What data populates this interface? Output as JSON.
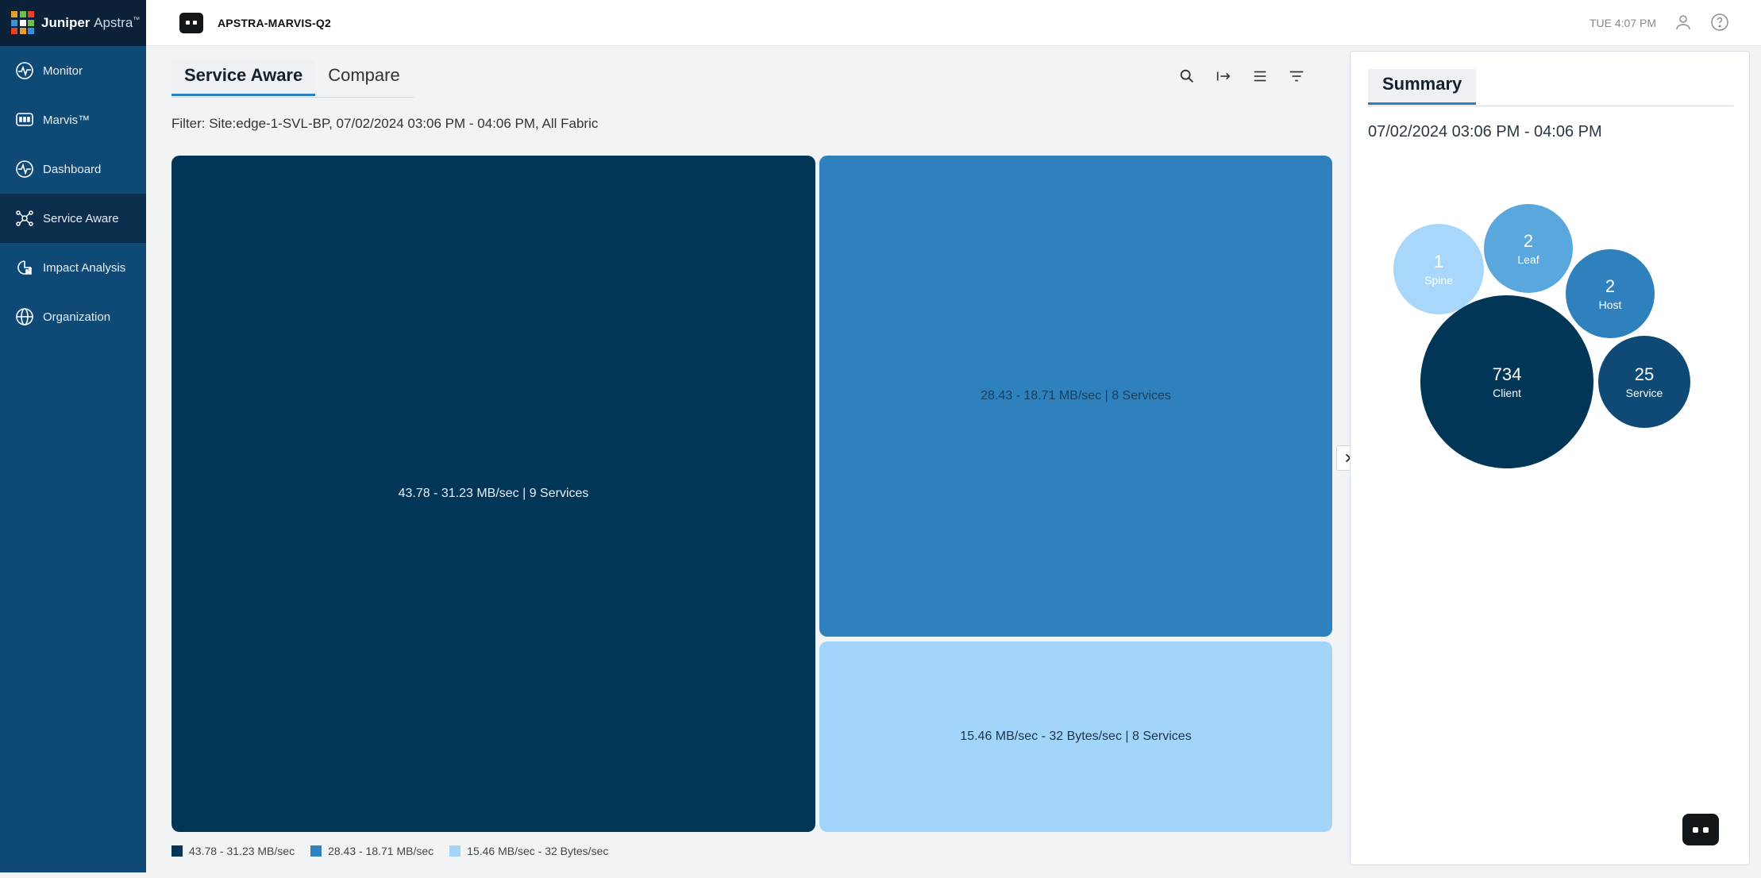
{
  "app": {
    "brand_bold": "Juniper",
    "brand_light": "Apstra",
    "brand_tm": "™"
  },
  "sidebar": {
    "items": [
      {
        "label": "Monitor",
        "icon": "monitor-icon"
      },
      {
        "label": "Marvis™",
        "icon": "marvis-icon"
      },
      {
        "label": "Dashboard",
        "icon": "dashboard-icon"
      },
      {
        "label": "Service Aware",
        "icon": "service-aware-icon",
        "active": true
      },
      {
        "label": "Impact Analysis",
        "icon": "impact-analysis-icon"
      },
      {
        "label": "Organization",
        "icon": "organization-icon"
      }
    ]
  },
  "header": {
    "org_name": "APSTRA-MARVIS-Q2",
    "time": "TUE 4:07 PM"
  },
  "main": {
    "tabs": [
      {
        "label": "Service Aware",
        "active": true
      },
      {
        "label": "Compare",
        "active": false
      }
    ],
    "filter": "Filter: Site:edge-1-SVL-BP, 07/02/2024 03:06 PM - 04:06 PM, All Fabric",
    "treemap": [
      {
        "label": "43.78 - 31.23 MB/sec | 9 Services",
        "color": "#013657"
      },
      {
        "label": "28.43 - 18.71 MB/sec | 8 Services",
        "color": "#2e81bc"
      },
      {
        "label": "15.46 MB/sec - 32 Bytes/sec | 8 Services",
        "color": "#a3d5fa"
      }
    ],
    "legend": [
      {
        "label": "43.78 - 31.23 MB/sec",
        "color": "#013657"
      },
      {
        "label": "28.43 - 18.71 MB/sec",
        "color": "#2e81bc"
      },
      {
        "label": "15.46 MB/sec - 32 Bytes/sec",
        "color": "#a3d5fa"
      }
    ]
  },
  "summary": {
    "tab": "Summary",
    "range": "07/02/2024 03:06 PM - 04:06 PM",
    "bubbles": [
      {
        "count": "1",
        "label": "Spine",
        "color": "#a3d5fa"
      },
      {
        "count": "2",
        "label": "Leaf",
        "color": "#5aa7dd"
      },
      {
        "count": "2",
        "label": "Host",
        "color": "#2e81bc"
      },
      {
        "count": "734",
        "label": "Client",
        "color": "#013657"
      },
      {
        "count": "25",
        "label": "Service",
        "color": "#0f4a77"
      }
    ]
  }
}
